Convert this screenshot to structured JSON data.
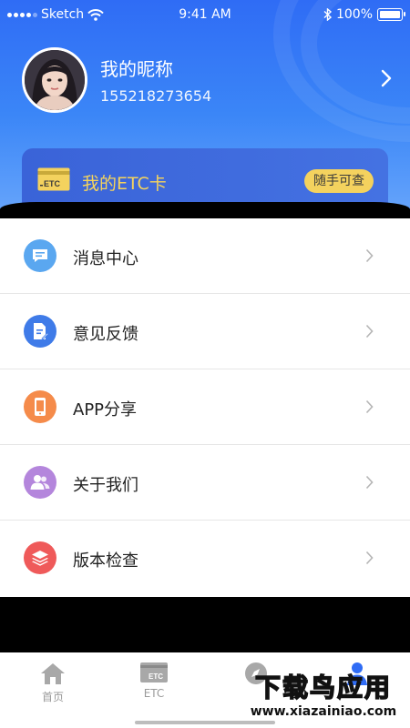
{
  "status_bar": {
    "carrier": "Sketch",
    "time": "9:41 AM",
    "battery": "100%"
  },
  "profile": {
    "name": "我的昵称",
    "phone": "155218273654"
  },
  "etc_card": {
    "icon_text": "ETC",
    "label": "我的ETC卡",
    "badge": "随手可查"
  },
  "menu": [
    {
      "label": "消息中心",
      "icon": "message-icon",
      "color": "#5aa7f0"
    },
    {
      "label": "意见反馈",
      "icon": "feedback-document-icon",
      "color": "#3f7be8"
    },
    {
      "label": "APP分享",
      "icon": "phone-share-icon",
      "color": "#f58b4a"
    },
    {
      "label": "关于我们",
      "icon": "users-icon",
      "color": "#b486dc"
    },
    {
      "label": "版本检查",
      "icon": "layers-icon",
      "color": "#ef5a5a"
    }
  ],
  "tabbar": [
    {
      "label": "首页",
      "icon": "home-icon"
    },
    {
      "label": "ETC",
      "icon": "etc-card-icon"
    },
    {
      "label": "",
      "icon": "compass-icon"
    },
    {
      "label": "",
      "icon": "user-icon",
      "active_color": "#2f6cf5"
    }
  ],
  "watermark": {
    "text": "下载鸟应用",
    "url": "www.xiazainiao.com"
  }
}
